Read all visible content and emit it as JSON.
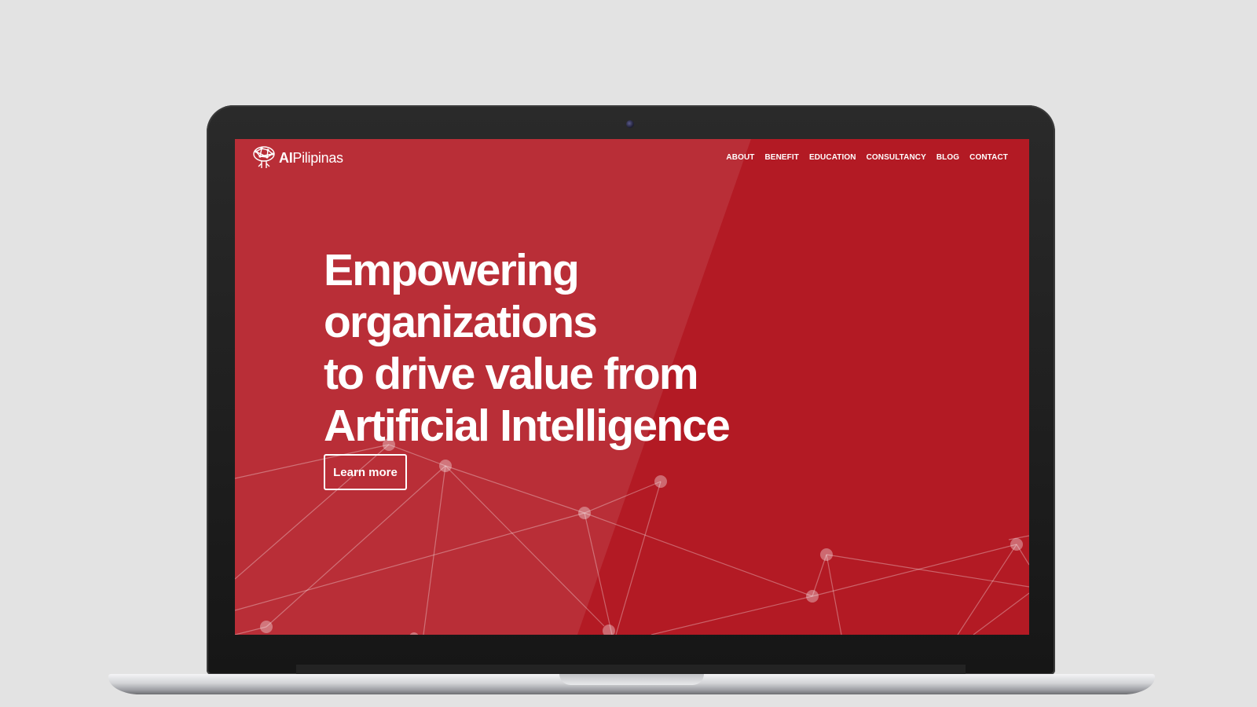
{
  "brand": {
    "logo_bold": "AI",
    "logo_light": "Pilipinas"
  },
  "nav": {
    "items": [
      {
        "label": "ABOUT"
      },
      {
        "label": "BENEFIT"
      },
      {
        "label": "EDUCATION"
      },
      {
        "label": "CONSULTANCY"
      },
      {
        "label": "BLOG"
      },
      {
        "label": "CONTACT"
      }
    ]
  },
  "hero": {
    "lines": [
      "Empowering",
      "organizations",
      "to drive value from",
      "Artificial Intelligence"
    ],
    "cta_label": "Learn more"
  },
  "colors": {
    "hero_background": "#b31a24",
    "text": "#ffffff",
    "page_background": "#e3e3e3"
  },
  "icons": {
    "logo": "tree-brain-icon",
    "background": "network-graph"
  }
}
